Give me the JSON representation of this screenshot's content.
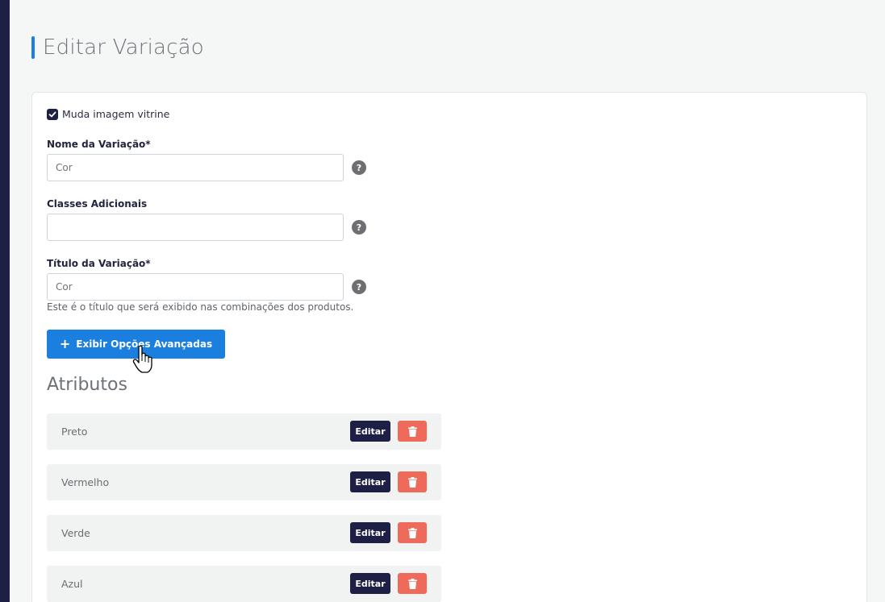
{
  "page": {
    "title": "Editar Variação",
    "accent_color": "#1b7fe0",
    "sidebar_color": "#1e1f45"
  },
  "form": {
    "checkbox": {
      "label": "Muda imagem vitrine",
      "checked": true
    },
    "fields": [
      {
        "label": "Nome da Variação*",
        "value": "Cor",
        "placeholder": ""
      },
      {
        "label": "Classes Adicionais",
        "value": "",
        "placeholder": ""
      },
      {
        "label": "Título da Variação*",
        "value": "Cor",
        "placeholder": ""
      }
    ],
    "help_icon": "?",
    "title_help_text": "Este é o título que será exibido nas combinações dos produtos.",
    "advanced_button_label": "Exibir Opções Avançadas"
  },
  "attributes": {
    "title": "Atributos",
    "edit_label": "Editar",
    "delete_icon": "trash-icon",
    "delete_color": "#ee6b5b",
    "items": [
      {
        "name": "Preto"
      },
      {
        "name": "Vermelho"
      },
      {
        "name": "Verde"
      },
      {
        "name": "Azul"
      }
    ]
  }
}
